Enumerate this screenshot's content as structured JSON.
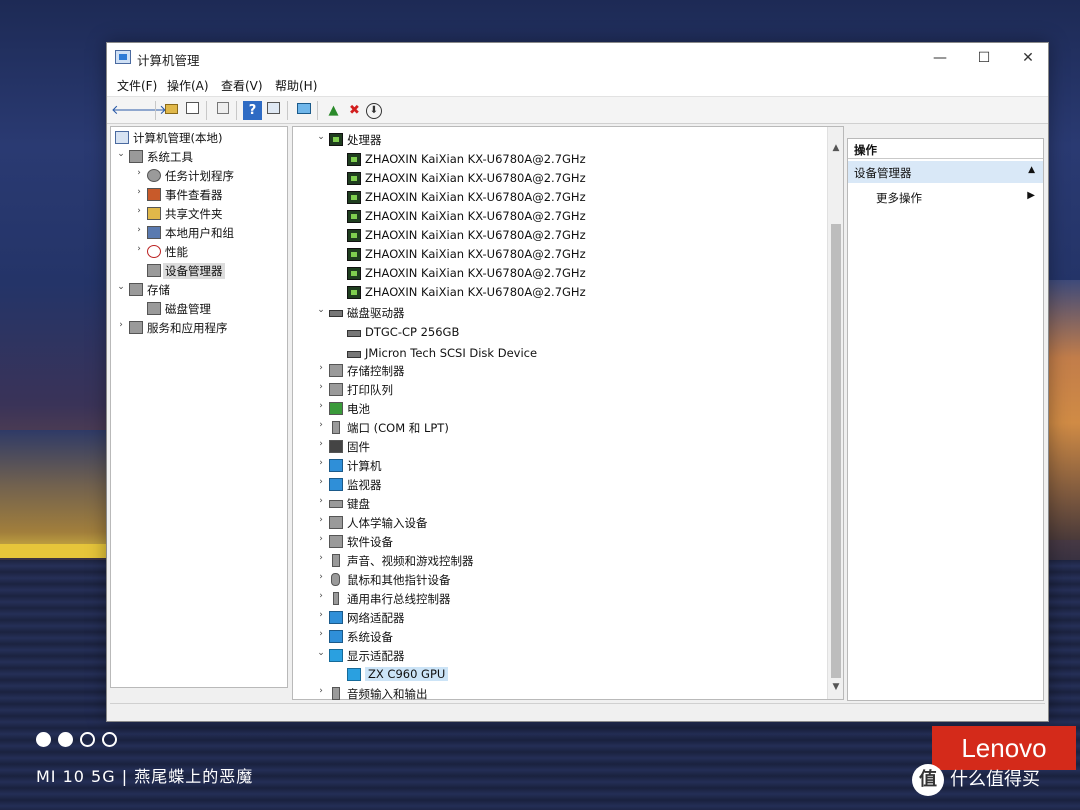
{
  "window": {
    "title": "计算机管理",
    "minimize": "—",
    "maximize": "☐",
    "close": "✕"
  },
  "menu": [
    "文件(F)",
    "操作(A)",
    "查看(V)",
    "帮助(H)"
  ],
  "toolbar": {
    "back": "🡐",
    "forward": "🡒",
    "help": "?",
    "delete": "✖",
    "download": "⬇"
  },
  "left_tree": [
    {
      "label": "计算机管理(本地)",
      "arrow": ""
    },
    {
      "label": "系统工具",
      "arrow": "⌄"
    },
    {
      "label": "任务计划程序",
      "arrow": "›"
    },
    {
      "label": "事件查看器",
      "arrow": "›"
    },
    {
      "label": "共享文件夹",
      "arrow": "›"
    },
    {
      "label": "本地用户和组",
      "arrow": "›"
    },
    {
      "label": "性能",
      "arrow": "›"
    },
    {
      "label": "设备管理器",
      "arrow": ""
    },
    {
      "label": "存储",
      "arrow": "⌄"
    },
    {
      "label": "磁盘管理",
      "arrow": ""
    },
    {
      "label": "服务和应用程序",
      "arrow": "›"
    }
  ],
  "device_tree": {
    "processors_label": "处理器",
    "processors": [
      "ZHAOXIN KaiXian KX-U6780A@2.7GHz",
      "ZHAOXIN KaiXian KX-U6780A@2.7GHz",
      "ZHAOXIN KaiXian KX-U6780A@2.7GHz",
      "ZHAOXIN KaiXian KX-U6780A@2.7GHz",
      "ZHAOXIN KaiXian KX-U6780A@2.7GHz",
      "ZHAOXIN KaiXian KX-U6780A@2.7GHz",
      "ZHAOXIN KaiXian KX-U6780A@2.7GHz",
      "ZHAOXIN KaiXian KX-U6780A@2.7GHz"
    ],
    "disk_drives_label": "磁盘驱动器",
    "disk_drives": [
      "DTGC-CP 256GB",
      "JMicron Tech SCSI Disk Device"
    ],
    "categories": [
      "存储控制器",
      "打印队列",
      "电池",
      "端口 (COM 和 LPT)",
      "固件",
      "计算机",
      "监视器",
      "键盘",
      "人体学输入设备",
      "软件设备",
      "声音、视频和游戏控制器",
      "鼠标和其他指针设备",
      "通用串行总线控制器",
      "网络适配器",
      "系统设备"
    ],
    "display_adapters_label": "显示适配器",
    "display_adapters": [
      "ZX C960 GPU"
    ],
    "audio_label": "音频输入和输出"
  },
  "actions": {
    "header": "操作",
    "section": "设备管理器",
    "more": "更多操作"
  },
  "overlay": {
    "camera": "MI 10 5G | 燕尾蝶上的恶魔",
    "brand": "Lenovo",
    "site": "什么值得买",
    "site_badge": "值"
  }
}
